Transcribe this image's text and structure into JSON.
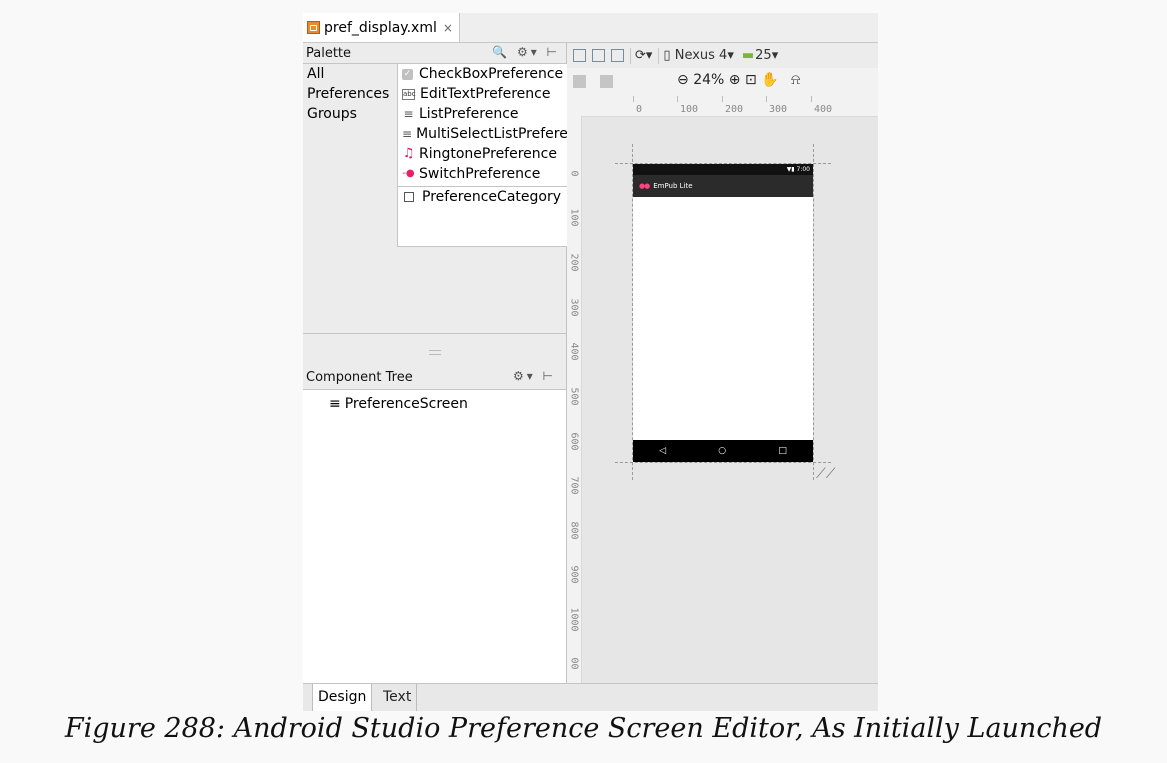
{
  "file_tab": {
    "name": "pref_display.xml",
    "close": "×"
  },
  "palette": {
    "title": "Palette",
    "tool_icons": "🔍 ⚙▾ ⊢",
    "categories": [
      "All",
      "Preferences",
      "Groups"
    ],
    "items": [
      {
        "label": "CheckBoxPreference",
        "icon": "checkbox-icon"
      },
      {
        "label": "EditTextPreference",
        "icon": "abc-icon"
      },
      {
        "label": "ListPreference",
        "icon": "list-icon"
      },
      {
        "label": "MultiSelectListPreference",
        "icon": "list-icon"
      },
      {
        "label": "RingtonePreference",
        "icon": "music-note-icon"
      },
      {
        "label": "SwitchPreference",
        "icon": "switch-icon"
      },
      {
        "label": "PreferenceCategory",
        "icon": "category-icon"
      }
    ]
  },
  "component_tree": {
    "title": "Component Tree",
    "tool_icons": "⚙▾ ⊢",
    "root": "PreferenceScreen"
  },
  "toolbar": {
    "device": "Nexus 4",
    "api": "25",
    "zoom": "24%"
  },
  "ruler": {
    "horizontal": [
      "0",
      "100",
      "200",
      "300",
      "400"
    ],
    "vertical": [
      "0",
      "100",
      "200",
      "300",
      "400",
      "500",
      "600",
      "700",
      "800",
      "900",
      "1000",
      "00"
    ]
  },
  "phone": {
    "status_time": "7:00",
    "app_title": "EmPub Lite"
  },
  "bottom_tabs": {
    "design": "Design",
    "text": "Text"
  },
  "caption": "Figure 288: Android Studio Preference Screen Editor, As Initially Launched"
}
